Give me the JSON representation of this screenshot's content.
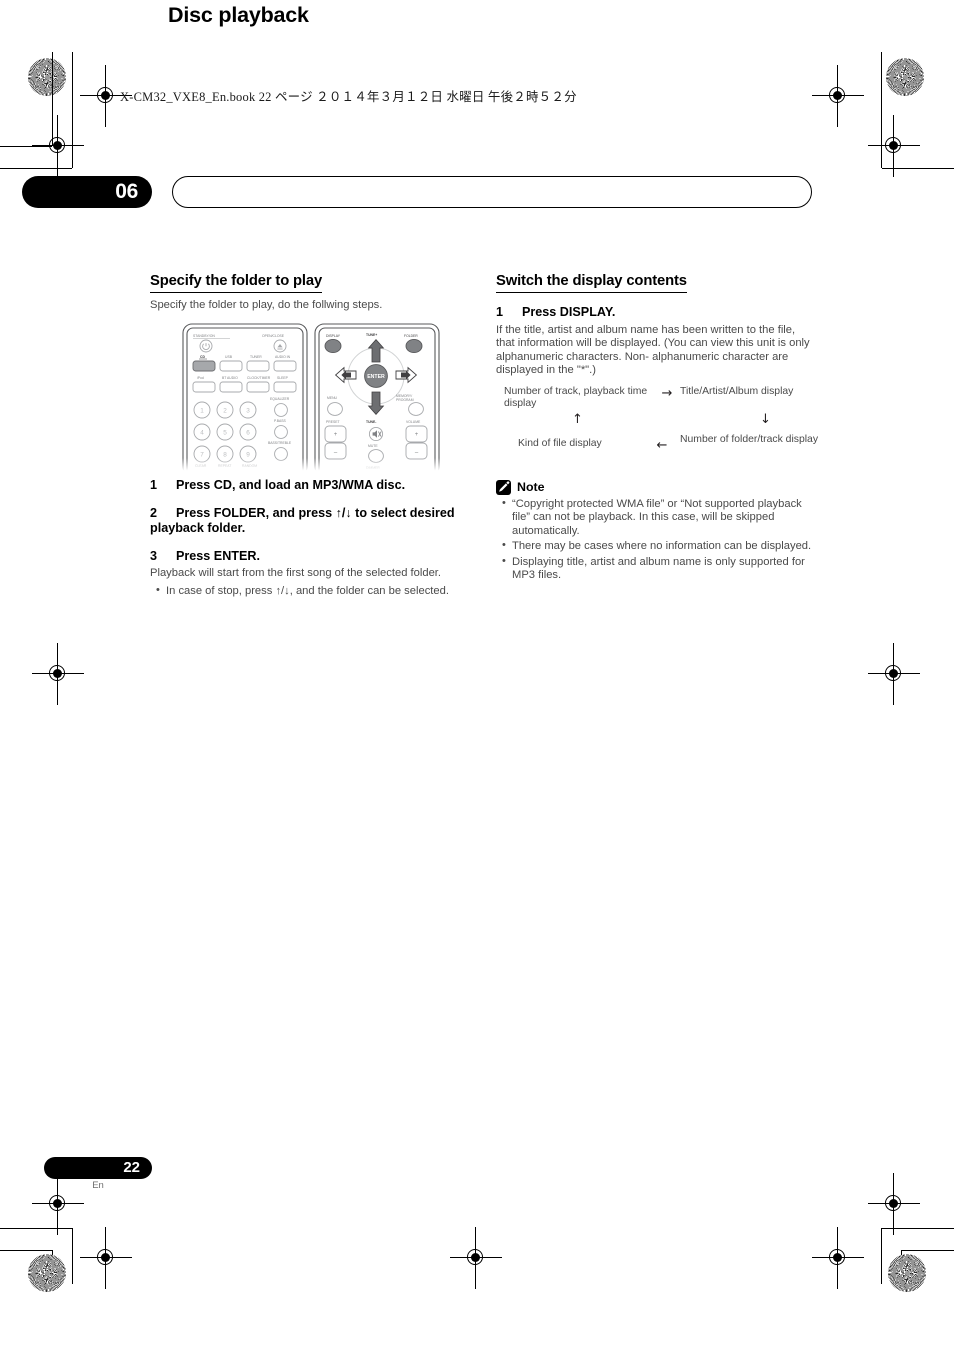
{
  "file_header": "X-CM32_VXE8_En.book   22 ページ   ２０１４年３月１２日   水曜日   午後２時５２分",
  "chapter": {
    "number": "06",
    "title": "Disc playback"
  },
  "left_column": {
    "section_title": "Specify the folder to play",
    "intro": "Specify the folder to play, do the follwing steps.",
    "steps": [
      {
        "n": "1",
        "text": "Press CD, and load an MP3/WMA disc."
      },
      {
        "n": "2",
        "text": "Press FOLDER, and press ↑/↓ to select desired playback folder."
      },
      {
        "n": "3",
        "text": "Press ENTER."
      }
    ],
    "step3_body": "Playback will start from the first song of the selected folder.",
    "step3_bullets": [
      "In case of stop, press ↑/↓, and the folder can be selected."
    ]
  },
  "right_column": {
    "section_title": "Switch the display contents",
    "step": {
      "n": "1",
      "text": "Press DISPLAY."
    },
    "body": "If the title, artist and album name has been written to the file, that information will be displayed. (You can view this unit is only alphanumeric characters. Non- alphanumeric character are displayed in the \"*\".)",
    "cycle": {
      "item_top_left": "Number of track, playback time display",
      "item_top_right": "Title/Artist/Album display",
      "item_bottom_right": "Number of folder/track display",
      "item_bottom_left": "Kind of file display",
      "arrow_top": "→",
      "arrow_right": "↓",
      "arrow_bottom": "←",
      "arrow_left": "↑"
    },
    "note": {
      "label": "Note",
      "icon": "pencil-icon",
      "items": [
        "“Copyright protected WMA file” or “Not supported playback file” can not be playback. In this case, will be skipped automatically.",
        "There may be cases where no information can be displayed.",
        "Displaying title, artist and album name is only supported for MP3 files."
      ]
    }
  },
  "remote": {
    "left_panel": {
      "label_standby": "STANDBY/ON",
      "label_open_close": "OPEN/CLOSE",
      "source_buttons": [
        "CD",
        "USB",
        "TUNER",
        "AUDIO IN"
      ],
      "source_buttons_row2": [
        "iPod",
        "BT AUDIO",
        "CLOCK/TIMER",
        "SLEEP"
      ],
      "selected_source": "CD",
      "numpad": [
        "1",
        "2",
        "3",
        "4",
        "5",
        "6",
        "7",
        "8",
        "9"
      ],
      "side_labels": [
        "EQUALIZER",
        "P.BASS",
        "BASS/TREBLE"
      ],
      "bottom_labels": [
        "CLEAR",
        "REPEAT",
        "RANDOM"
      ]
    },
    "right_panel": {
      "label_display": "DISPLAY",
      "label_tune_up": "TUNE+",
      "label_folder": "FOLDER",
      "label_enter": "ENTER",
      "label_menu": "MENU",
      "label_memory": "MEMORY/PROGRAM",
      "label_preset": "PRESET",
      "label_tune_down": "TUNE-",
      "label_volume": "VOLUME",
      "label_mute": "MUTE",
      "label_dimmer": "DIMMER",
      "plus": "+",
      "minus": "−"
    }
  },
  "footer": {
    "page_number": "22",
    "language": "En"
  },
  "colors": {
    "ink": "#231f20",
    "body_grey": "#4a4a4a",
    "accent_black": "#000000"
  }
}
